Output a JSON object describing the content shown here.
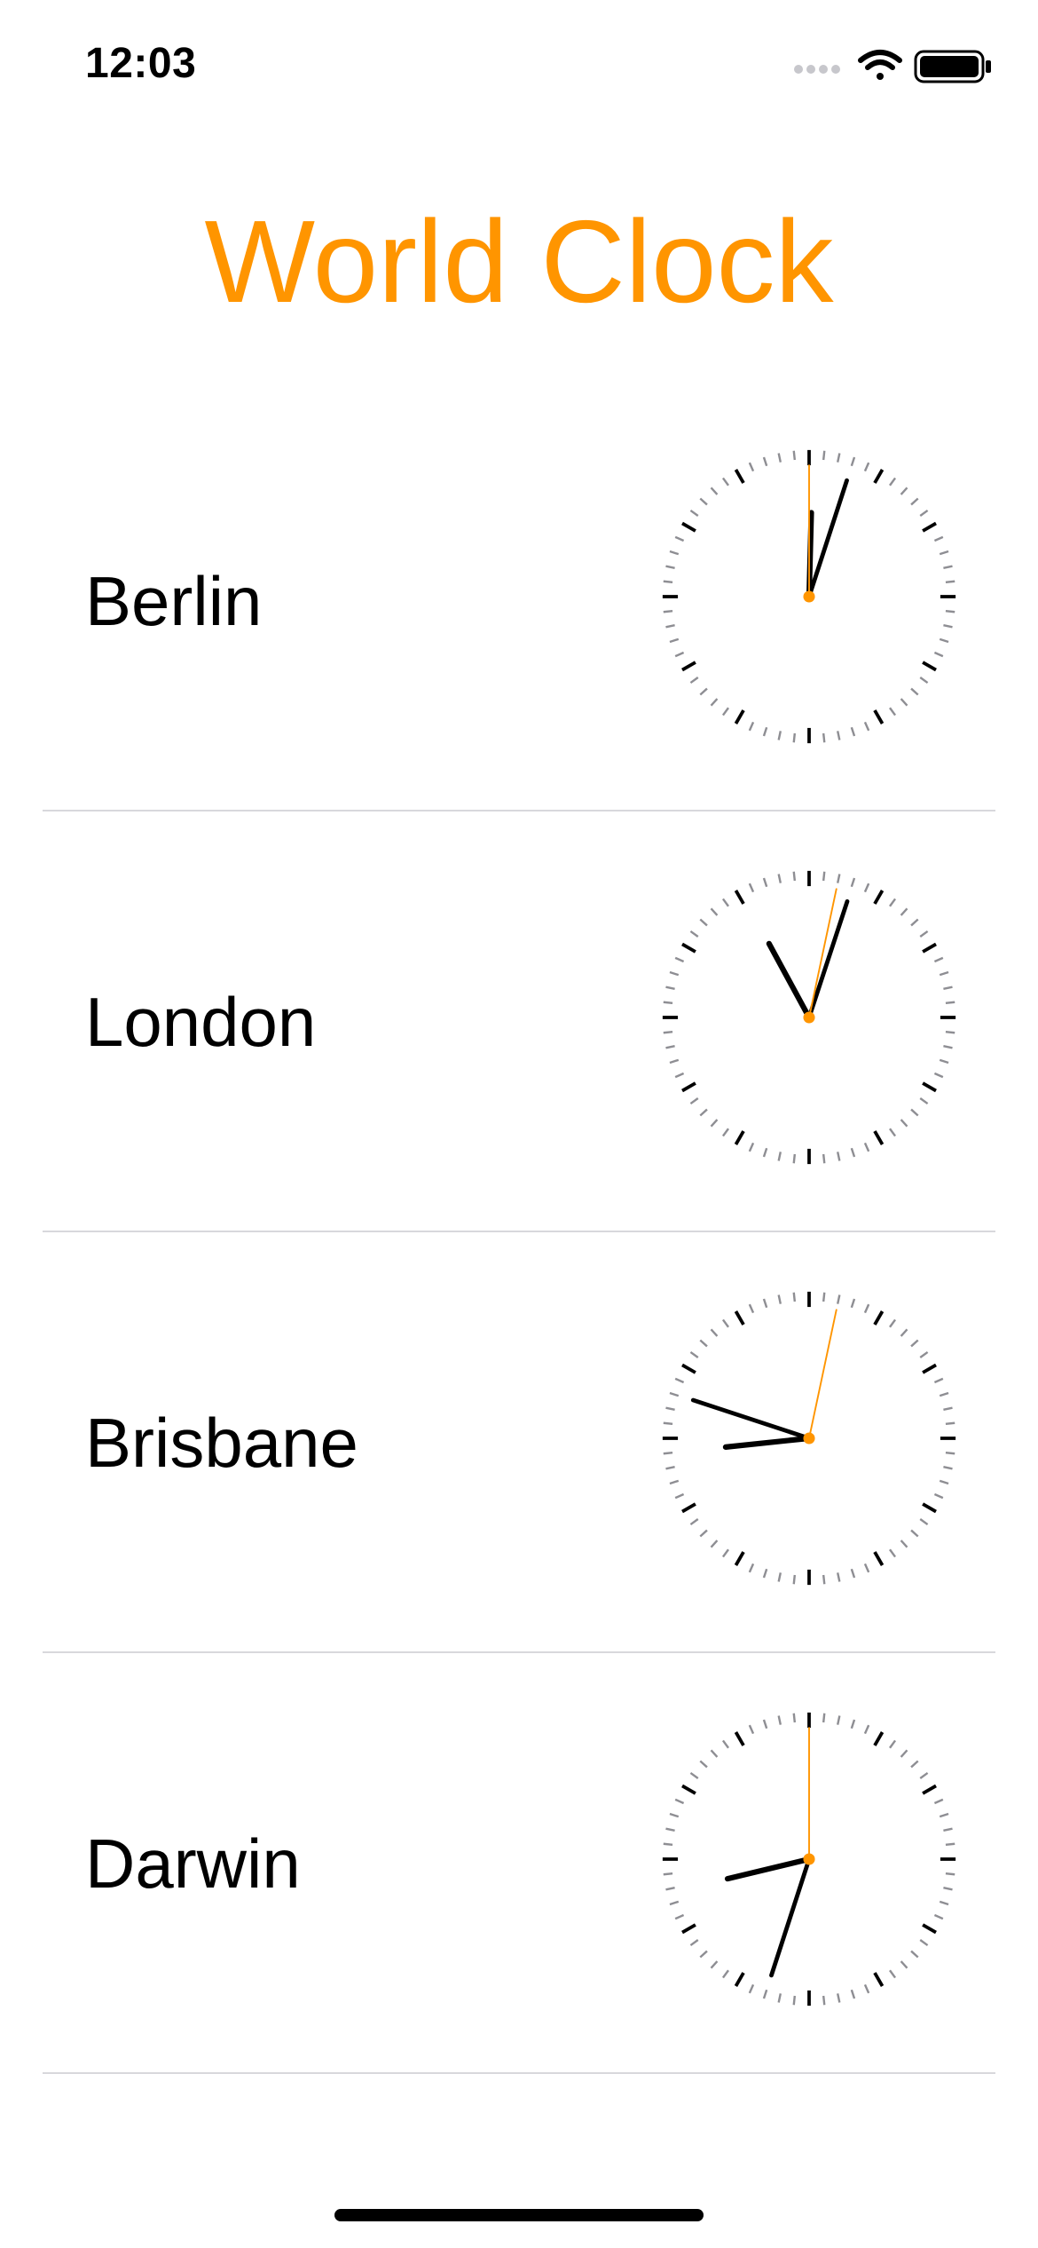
{
  "status_bar": {
    "time": "12:03",
    "icons": [
      "signal-dots-icon",
      "wifi-icon",
      "battery-icon"
    ]
  },
  "title": "World Clock",
  "colors": {
    "accent": "#FF9500",
    "hand": "#000000",
    "tick_major": "#000000",
    "tick_minor": "#8e8e93",
    "divider": "#d8d8dc"
  },
  "clocks": [
    {
      "city": "Berlin",
      "hour": 12,
      "minute": 3,
      "second": 0
    },
    {
      "city": "London",
      "hour": 11,
      "minute": 3,
      "second": 2
    },
    {
      "city": "Brisbane",
      "hour": 8,
      "minute": 48,
      "second": 2
    },
    {
      "city": "Darwin",
      "hour": 8,
      "minute": 33,
      "second": 0
    }
  ]
}
